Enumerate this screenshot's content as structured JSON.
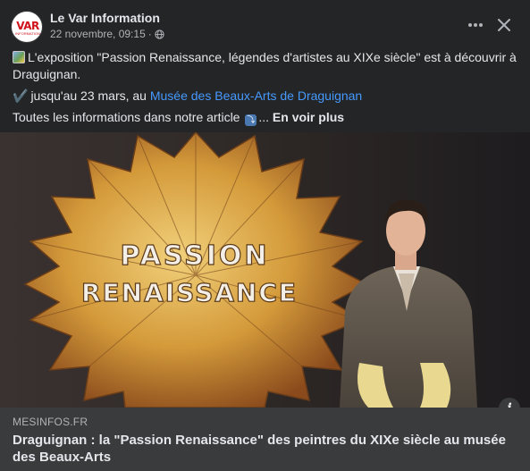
{
  "post": {
    "page_name": "Le Var Information",
    "avatar_text": "VAR",
    "avatar_subtext": "INFORMATION",
    "timestamp": "22 novembre, 09:15",
    "separator": "·",
    "privacy_icon": "globe-icon",
    "more_icon": "more-horizontal-icon",
    "close_icon": "close-icon"
  },
  "body": {
    "line1_emoji": "framed-picture-emoji",
    "line1": "L'exposition \"Passion Renaissance, légendes d'artistes au XIXe siècle\" est à découvrir à Draguignan.",
    "line2_check": "✔️",
    "line2_prefix": "jusqu'au 23 mars, au ",
    "line2_link": "Musée des Beaux-Arts de Draguignan",
    "line3_prefix": "Toutes les informations dans notre article",
    "line3_emoji": "⤵",
    "line3_ellipsis": "...",
    "see_more": "En voir plus"
  },
  "media": {
    "sign_line1": "PASSION",
    "sign_line2": "RENAISSANCE",
    "info_label": "i"
  },
  "preview": {
    "domain": "MESINFOS.FR",
    "headline": "Draguignan : la \"Passion Renaissance\" des peintres du XIXe siècle au musée des Beaux-Arts"
  },
  "colors": {
    "background": "#242526",
    "preview_bg": "#3a3b3c",
    "link": "#4599ff",
    "gold": "#c9962e"
  }
}
